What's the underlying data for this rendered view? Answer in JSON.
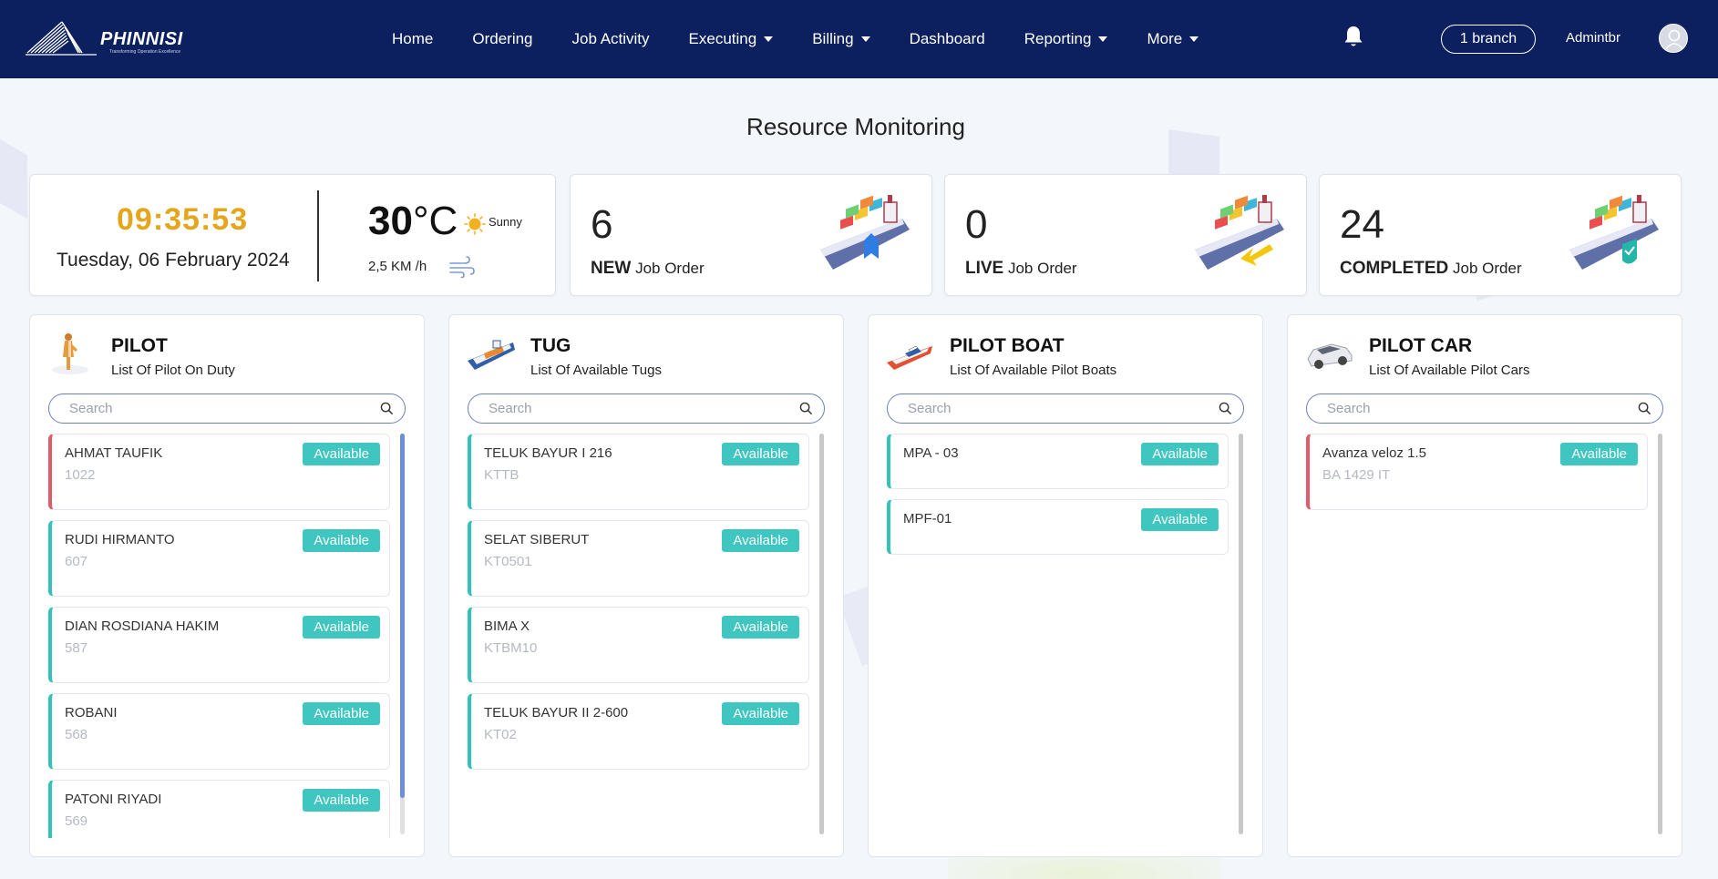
{
  "brand": {
    "name": "PHINNISI",
    "tagline": "Transforming Operation Excellence"
  },
  "nav": {
    "items": [
      {
        "label": "Home",
        "dropdown": false
      },
      {
        "label": "Ordering",
        "dropdown": false
      },
      {
        "label": "Job Activity",
        "dropdown": false
      },
      {
        "label": "Executing",
        "dropdown": true
      },
      {
        "label": "Billing",
        "dropdown": true
      },
      {
        "label": "Dashboard",
        "dropdown": false
      },
      {
        "label": "Reporting",
        "dropdown": true
      },
      {
        "label": "More",
        "dropdown": true
      }
    ],
    "branch_button": "1 branch",
    "user_name": "Admintbr"
  },
  "page": {
    "title": "Resource Monitoring"
  },
  "clock": {
    "time": "09:35:53",
    "date": "Tuesday, 06 February 2024",
    "temperature": "30",
    "temperature_unit": "°C",
    "condition": "Sunny",
    "wind": "2,5 KM /h"
  },
  "jobs": {
    "new": {
      "count": "6",
      "label_bold": "NEW",
      "label": "Job Order"
    },
    "live": {
      "count": "0",
      "label_bold": "LIVE",
      "label": "Job Order"
    },
    "completed": {
      "count": "24",
      "label_bold": "COMPLETED",
      "label": "Job Order"
    }
  },
  "panels": [
    {
      "title": "PILOT",
      "subtitle": "List Of Pilot On Duty",
      "search_placeholder": "Search",
      "items": [
        {
          "name": "AHMAT TAUFIK",
          "code": "1022",
          "status": "Available",
          "accent": "red"
        },
        {
          "name": "RUDI HIRMANTO",
          "code": "607",
          "status": "Available",
          "accent": "teal"
        },
        {
          "name": "DIAN ROSDIANA HAKIM",
          "code": "587",
          "status": "Available",
          "accent": "teal"
        },
        {
          "name": "ROBANI",
          "code": "568",
          "status": "Available",
          "accent": "teal"
        },
        {
          "name": "PATONI RIYADI",
          "code": "569",
          "status": "Available",
          "accent": "teal"
        }
      ]
    },
    {
      "title": "TUG",
      "subtitle": "List Of Available Tugs",
      "search_placeholder": "Search",
      "items": [
        {
          "name": "TELUK BAYUR I 216",
          "code": "KTTB",
          "status": "Available",
          "accent": "teal"
        },
        {
          "name": "SELAT SIBERUT",
          "code": "KT0501",
          "status": "Available",
          "accent": "teal"
        },
        {
          "name": "BIMA X",
          "code": "KTBM10",
          "status": "Available",
          "accent": "teal"
        },
        {
          "name": "TELUK BAYUR II 2-600",
          "code": "KT02",
          "status": "Available",
          "accent": "teal"
        }
      ]
    },
    {
      "title": "PILOT BOAT",
      "subtitle": "List Of Available Pilot Boats",
      "search_placeholder": "Search",
      "items": [
        {
          "name": "MPA - 03",
          "code": "",
          "status": "Available",
          "accent": "teal"
        },
        {
          "name": "MPF-01",
          "code": "",
          "status": "Available",
          "accent": "teal"
        }
      ]
    },
    {
      "title": "PILOT CAR",
      "subtitle": "List Of Available Pilot Cars",
      "search_placeholder": "Search",
      "items": [
        {
          "name": "Avanza veloz 1.5",
          "code": "BA 1429 IT",
          "status": "Available",
          "accent": "red"
        }
      ]
    }
  ],
  "colors": {
    "nav_bg": "#0c1f5f",
    "clock": "#e5a51d",
    "badge": "#3fc6c0",
    "accent_teal": "#33c3bb",
    "accent_red": "#e35a68"
  }
}
